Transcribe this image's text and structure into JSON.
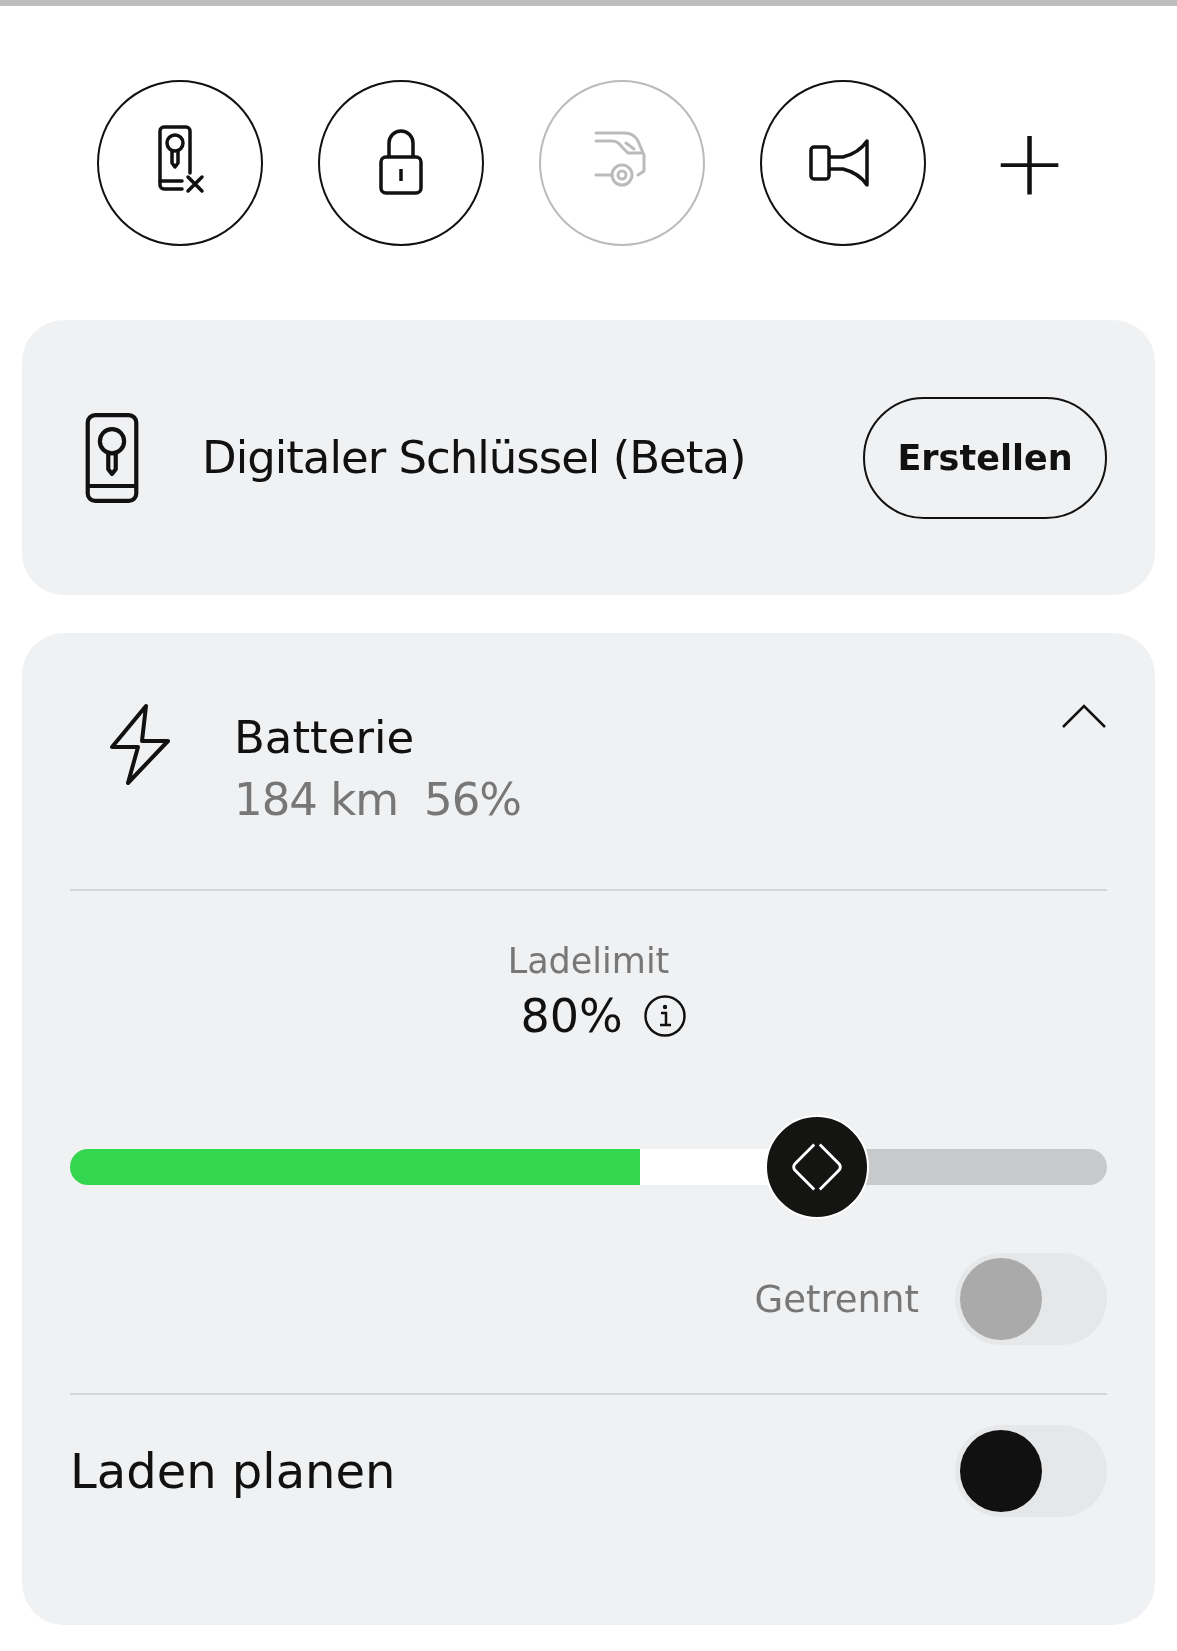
{
  "quick_actions": [
    {
      "kind": "key",
      "disabled": false
    },
    {
      "kind": "lock",
      "disabled": false
    },
    {
      "kind": "car",
      "disabled": true
    },
    {
      "kind": "horn",
      "disabled": false
    }
  ],
  "add_action": {
    "label": "+"
  },
  "digital_key": {
    "title": "Digitaler Schlüssel (Beta)",
    "button": "Erstellen"
  },
  "battery": {
    "title": "Batterie",
    "range": "184 km",
    "percent": "56%",
    "expanded": true,
    "charge_limit": {
      "label": "Ladelimit",
      "value": "80%",
      "charge": {
        "level": 0.55
      },
      "level": 0.72
    },
    "connection": {
      "label": "Getrennt",
      "on": false,
      "disabled": true
    },
    "schedule": {
      "label": "Laden planen",
      "on": false,
      "disabled": false
    }
  }
}
